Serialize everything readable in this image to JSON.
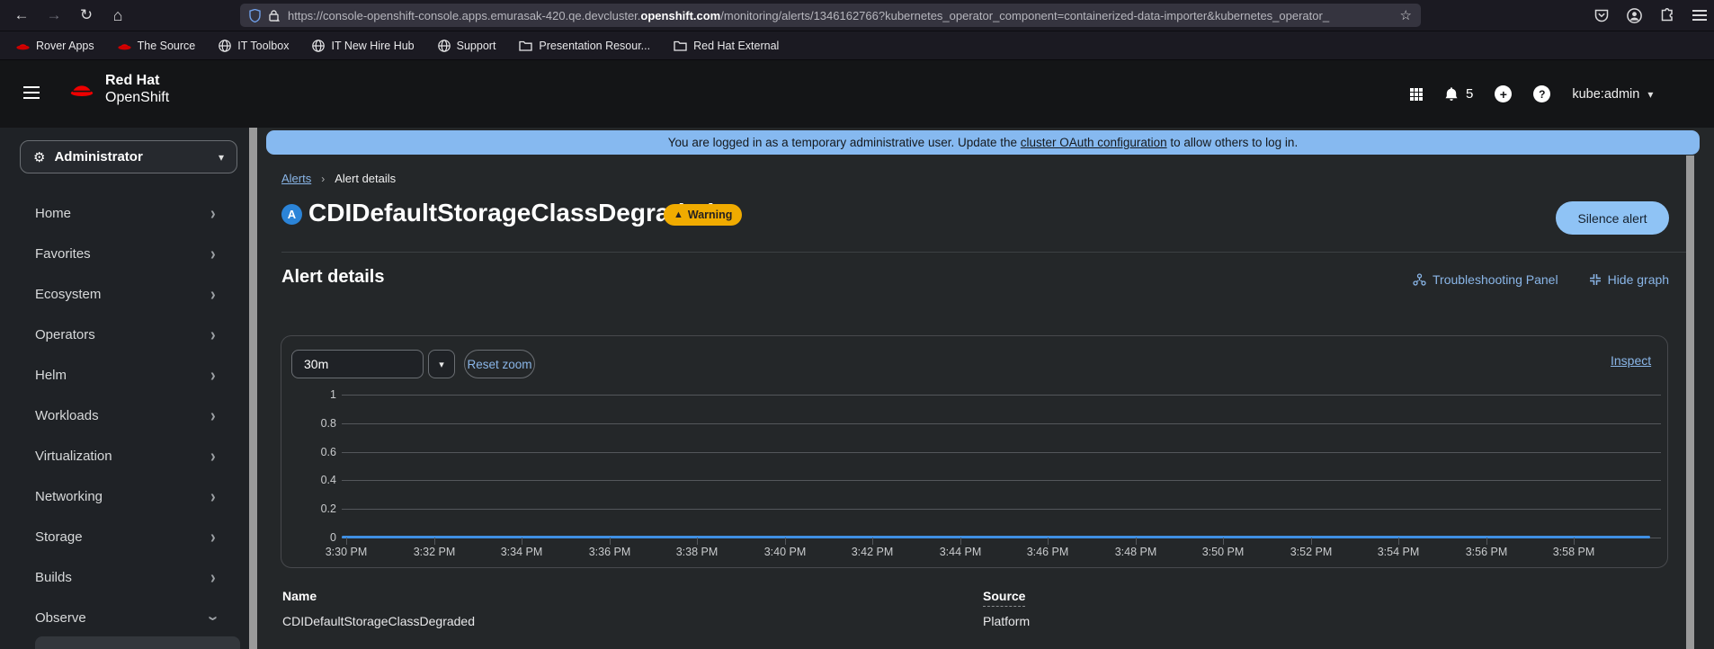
{
  "browser": {
    "url_prefix": "https://console-openshift-console.apps.emurasak-420.qe.devcluster.",
    "url_domain": "openshift.com",
    "url_path": "/monitoring/alerts/1346162766?kubernetes_operator_component=containerized-data-importer&kubernetes_operator_",
    "bookmarks": [
      {
        "label": "Rover Apps",
        "icon": "redhat"
      },
      {
        "label": "The Source",
        "icon": "redhat"
      },
      {
        "label": "IT Toolbox",
        "icon": "globe"
      },
      {
        "label": "IT New Hire Hub",
        "icon": "globe"
      },
      {
        "label": "Support",
        "icon": "globe"
      },
      {
        "label": "Presentation Resour...",
        "icon": "folder"
      },
      {
        "label": "Red Hat External",
        "icon": "folder"
      }
    ]
  },
  "masthead": {
    "brand_line1": "Red Hat",
    "brand_line2": "OpenShift",
    "notification_count": "5",
    "username": "kube:admin"
  },
  "sidebar": {
    "perspective": "Administrator",
    "items": [
      {
        "label": "Home",
        "expanded": false
      },
      {
        "label": "Favorites",
        "expanded": false
      },
      {
        "label": "Ecosystem",
        "expanded": false
      },
      {
        "label": "Operators",
        "expanded": false
      },
      {
        "label": "Helm",
        "expanded": false
      },
      {
        "label": "Workloads",
        "expanded": false
      },
      {
        "label": "Virtualization",
        "expanded": false
      },
      {
        "label": "Networking",
        "expanded": false
      },
      {
        "label": "Storage",
        "expanded": false
      },
      {
        "label": "Builds",
        "expanded": false
      },
      {
        "label": "Observe",
        "expanded": true
      }
    ]
  },
  "banner": {
    "text_before": "You are logged in as a temporary administrative user. Update the ",
    "link_text": "cluster OAuth configuration",
    "text_after": " to allow others to log in."
  },
  "breadcrumb": {
    "parent": "Alerts",
    "current": "Alert details"
  },
  "alert": {
    "severity_letter": "A",
    "title": "CDIDefaultStorageClassDegraded",
    "badge": "Warning",
    "silence_button": "Silence alert"
  },
  "details_section": {
    "heading": "Alert details",
    "troubleshooting_link": "Troubleshooting Panel",
    "hide_graph_link": "Hide graph",
    "duration_value": "30m",
    "reset_zoom_label": "Reset zoom",
    "inspect_link": "Inspect"
  },
  "chart_data": {
    "type": "line",
    "title": "",
    "xlabel": "",
    "ylabel": "",
    "ylim": [
      0,
      1
    ],
    "grid": true,
    "legend": "none",
    "x_tick_labels": [
      "3:30 PM",
      "3:32 PM",
      "3:34 PM",
      "3:36 PM",
      "3:38 PM",
      "3:40 PM",
      "3:42 PM",
      "3:44 PM",
      "3:46 PM",
      "3:48 PM",
      "3:50 PM",
      "3:52 PM",
      "3:54 PM",
      "3:56 PM",
      "3:58 PM"
    ],
    "y_tick_labels": [
      "1",
      "0.8",
      "0.6",
      "0.4",
      "0.2",
      "0"
    ],
    "series": [
      {
        "name": "",
        "color": "#3f8fe3",
        "values": [
          0,
          0,
          0,
          0,
          0,
          0,
          0,
          0,
          0,
          0,
          0,
          0,
          0,
          0,
          0
        ]
      }
    ]
  },
  "fields": {
    "name_label": "Name",
    "name_value": "CDIDefaultStorageClassDegraded",
    "source_label": "Source",
    "source_value": "Platform"
  },
  "colors": {
    "accent_blue": "#8ab6e8",
    "primary_button": "#8fc3f5",
    "warning": "#f0ab00",
    "banner": "#86b9f0",
    "series": "#3f8fe3"
  }
}
